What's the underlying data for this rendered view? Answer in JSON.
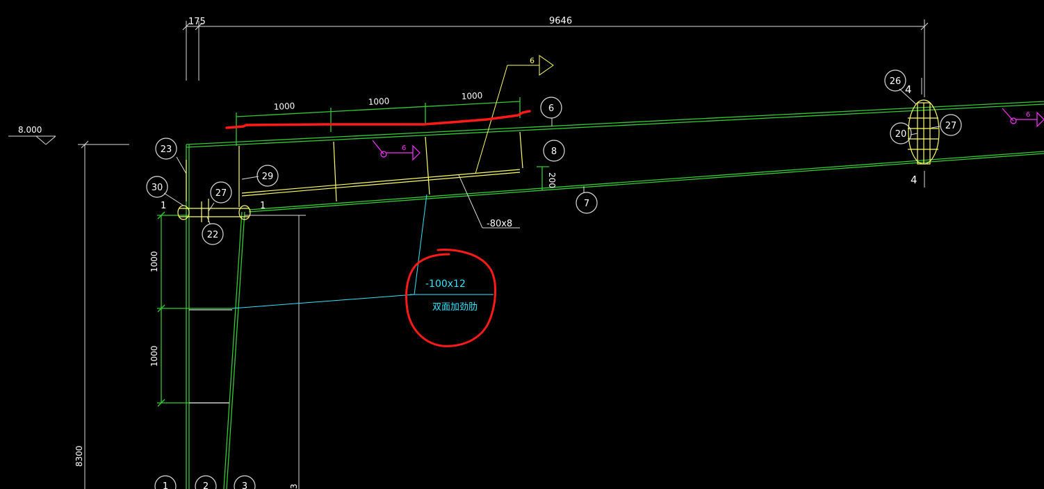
{
  "dimensions": {
    "top_small": "175",
    "top_overall": "9646",
    "stiffener_spacing": [
      "1000",
      "1000",
      "1000"
    ],
    "haunch_depth": "200",
    "column_spacing": [
      "1000",
      "1000"
    ],
    "column_height": "8300",
    "bottom_right_partial": "3"
  },
  "elevation": {
    "value": "8.000"
  },
  "callouts": {
    "c23": "23",
    "c30": "30",
    "c27_left": "27",
    "c22": "22",
    "c29": "29",
    "c6": "6",
    "c8": "8",
    "c7": "7",
    "c26": "26",
    "c20": "20",
    "c27_right": "27",
    "c1": "1",
    "c2": "2",
    "c3": "3"
  },
  "section_marks": {
    "left_1a": "1",
    "left_1b": "1",
    "right_4a": "4",
    "right_4b": "4"
  },
  "weld_symbols": {
    "top_flag": "6",
    "middle": "6",
    "right": "6"
  },
  "plates": {
    "flange_plate": "-80x8",
    "stiffener_spec": "-100x12",
    "stiffener_note": "双面加劲肋"
  },
  "colors": {
    "background": "#000000",
    "member_lines": "#33cc33",
    "dimension_lines": "#ffffff",
    "stiffener_lines": "#ffff66",
    "leader_cyan": "#33e6ff",
    "weld_magenta": "#ff33ff",
    "markup_red": "#ff1a1a"
  }
}
